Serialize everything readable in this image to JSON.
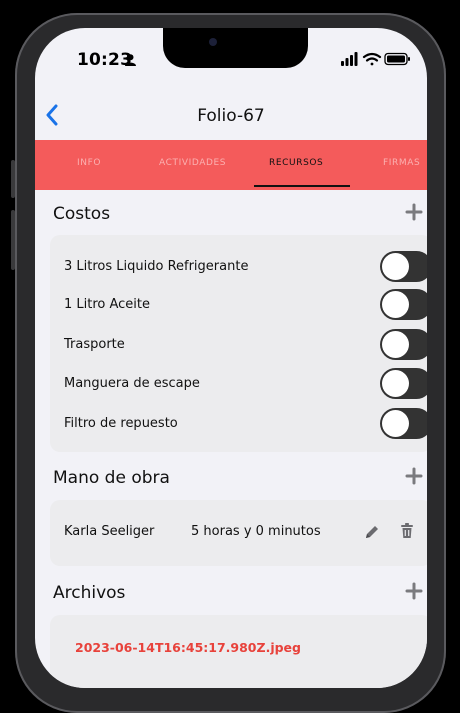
{
  "status_bar": {
    "time": "10:23"
  },
  "nav": {
    "title": "Folio-67"
  },
  "tabs": [
    {
      "label": "INFO",
      "active": false
    },
    {
      "label": "ACTIVIDADES",
      "active": false
    },
    {
      "label": "RECURSOS",
      "active": true
    },
    {
      "label": "FIRMAS",
      "active": false
    }
  ],
  "costs": {
    "title": "Costos",
    "items": [
      {
        "label": "3 Litros Liquido Refrigerante",
        "enabled": false
      },
      {
        "label": "1 Litro Aceite",
        "enabled": false
      },
      {
        "label": "Trasporte",
        "enabled": false
      },
      {
        "label": "Manguera de escape",
        "enabled": false
      },
      {
        "label": "Filtro de repuesto",
        "enabled": false
      }
    ]
  },
  "labor": {
    "title": "Mano de obra",
    "entries": [
      {
        "name": "Karla Seeliger",
        "time": "5 horas y 0 minutos"
      }
    ]
  },
  "files": {
    "title": "Archivos",
    "items": [
      {
        "name": "2023-06-14T16:45:17.980Z.jpeg"
      }
    ]
  },
  "colors": {
    "accent": "#f45b5b",
    "file_link": "#e8423b",
    "toggle_off": "#333333"
  }
}
